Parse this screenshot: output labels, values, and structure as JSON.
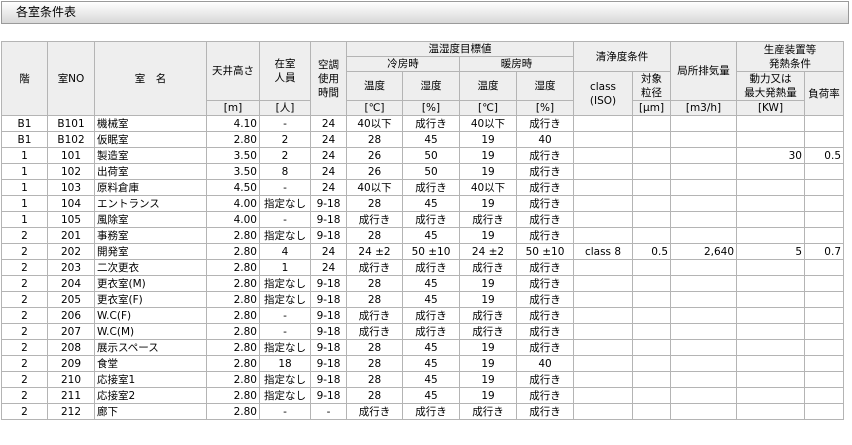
{
  "title": "各室条件表",
  "headers": {
    "floor": "階",
    "room_no": "室NO",
    "room_name": "室　名",
    "ceiling_height": "天井高さ",
    "occupants_1": "在室",
    "occupants_2": "人員",
    "ac_time_1": "空調",
    "ac_time_2": "使用",
    "ac_time_3": "時間",
    "temp_target": "温湿度目標値",
    "cooling": "冷房時",
    "heating": "暖房時",
    "temp": "温度",
    "humidity": "湿度",
    "cleanliness": "清浄度条件",
    "class_1": "class",
    "class_2": "(ISO)",
    "particle_1": "対象",
    "particle_2": "粒径",
    "exhaust": "局所排気量",
    "equipment_1": "生産装置等",
    "equipment_2": "発熱条件",
    "power_1": "動力又は",
    "power_2": "最大発熱量",
    "load_factor": "負荷率"
  },
  "units": {
    "ceiling_height": "[m]",
    "occupants": "[人]",
    "temp": "[℃]",
    "humidity": "[%]",
    "particle": "[μm]",
    "exhaust": "[m3/h]",
    "power": "[KW]"
  },
  "rows": [
    {
      "floor": "B1",
      "no": "B101",
      "name": "機械室",
      "height": "4.10",
      "people": "-",
      "time": "24",
      "ct": "40以下",
      "ch": "成行き",
      "ht": "40以下",
      "hh": "成行き",
      "cls": "",
      "part": "",
      "exh": "",
      "pow": "",
      "load": ""
    },
    {
      "floor": "B1",
      "no": "B102",
      "name": "仮眠室",
      "height": "2.80",
      "people": "2",
      "time": "24",
      "ct": "28",
      "ch": "45",
      "ht": "19",
      "hh": "40",
      "cls": "",
      "part": "",
      "exh": "",
      "pow": "",
      "load": ""
    },
    {
      "floor": "1",
      "no": "101",
      "name": "製造室",
      "height": "3.50",
      "people": "2",
      "time": "24",
      "ct": "26",
      "ch": "50",
      "ht": "19",
      "hh": "成行き",
      "cls": "",
      "part": "",
      "exh": "",
      "pow": "30",
      "load": "0.5"
    },
    {
      "floor": "1",
      "no": "102",
      "name": "出荷室",
      "height": "3.50",
      "people": "8",
      "time": "24",
      "ct": "26",
      "ch": "50",
      "ht": "19",
      "hh": "成行き",
      "cls": "",
      "part": "",
      "exh": "",
      "pow": "",
      "load": ""
    },
    {
      "floor": "1",
      "no": "103",
      "name": "原料倉庫",
      "height": "4.50",
      "people": "-",
      "time": "24",
      "ct": "40以下",
      "ch": "成行き",
      "ht": "40以下",
      "hh": "成行き",
      "cls": "",
      "part": "",
      "exh": "",
      "pow": "",
      "load": ""
    },
    {
      "floor": "1",
      "no": "104",
      "name": "エントランス",
      "height": "4.00",
      "people": "指定なし",
      "time": "9-18",
      "ct": "28",
      "ch": "45",
      "ht": "19",
      "hh": "成行き",
      "cls": "",
      "part": "",
      "exh": "",
      "pow": "",
      "load": ""
    },
    {
      "floor": "1",
      "no": "105",
      "name": "風除室",
      "height": "4.00",
      "people": "-",
      "time": "9-18",
      "ct": "成行き",
      "ch": "成行き",
      "ht": "成行き",
      "hh": "成行き",
      "cls": "",
      "part": "",
      "exh": "",
      "pow": "",
      "load": ""
    },
    {
      "floor": "2",
      "no": "201",
      "name": "事務室",
      "height": "2.80",
      "people": "指定なし",
      "time": "9-18",
      "ct": "28",
      "ch": "45",
      "ht": "19",
      "hh": "成行き",
      "cls": "",
      "part": "",
      "exh": "",
      "pow": "",
      "load": ""
    },
    {
      "floor": "2",
      "no": "202",
      "name": "開発室",
      "height": "2.80",
      "people": "4",
      "time": "24",
      "ct": "24 ±2",
      "ch": "50 ±10",
      "ht": "24 ±2",
      "hh": "50 ±10",
      "cls": "class 8",
      "part": "0.5",
      "exh": "2,640",
      "pow": "5",
      "load": "0.7"
    },
    {
      "floor": "2",
      "no": "203",
      "name": "二次更衣",
      "height": "2.80",
      "people": "1",
      "time": "24",
      "ct": "成行き",
      "ch": "成行き",
      "ht": "成行き",
      "hh": "成行き",
      "cls": "",
      "part": "",
      "exh": "",
      "pow": "",
      "load": ""
    },
    {
      "floor": "2",
      "no": "204",
      "name": "更衣室(M)",
      "height": "2.80",
      "people": "指定なし",
      "time": "9-18",
      "ct": "28",
      "ch": "45",
      "ht": "19",
      "hh": "成行き",
      "cls": "",
      "part": "",
      "exh": "",
      "pow": "",
      "load": ""
    },
    {
      "floor": "2",
      "no": "205",
      "name": "更衣室(F)",
      "height": "2.80",
      "people": "指定なし",
      "time": "9-18",
      "ct": "28",
      "ch": "45",
      "ht": "19",
      "hh": "成行き",
      "cls": "",
      "part": "",
      "exh": "",
      "pow": "",
      "load": ""
    },
    {
      "floor": "2",
      "no": "206",
      "name": "W.C(F)",
      "height": "2.80",
      "people": "-",
      "time": "9-18",
      "ct": "成行き",
      "ch": "成行き",
      "ht": "成行き",
      "hh": "成行き",
      "cls": "",
      "part": "",
      "exh": "",
      "pow": "",
      "load": ""
    },
    {
      "floor": "2",
      "no": "207",
      "name": "W.C(M)",
      "height": "2.80",
      "people": "-",
      "time": "9-18",
      "ct": "成行き",
      "ch": "成行き",
      "ht": "成行き",
      "hh": "成行き",
      "cls": "",
      "part": "",
      "exh": "",
      "pow": "",
      "load": ""
    },
    {
      "floor": "2",
      "no": "208",
      "name": "展示スペース",
      "height": "2.80",
      "people": "指定なし",
      "time": "9-18",
      "ct": "28",
      "ch": "45",
      "ht": "19",
      "hh": "成行き",
      "cls": "",
      "part": "",
      "exh": "",
      "pow": "",
      "load": ""
    },
    {
      "floor": "2",
      "no": "209",
      "name": "食堂",
      "height": "2.80",
      "people": "18",
      "time": "9-18",
      "ct": "28",
      "ch": "45",
      "ht": "19",
      "hh": "40",
      "cls": "",
      "part": "",
      "exh": "",
      "pow": "",
      "load": ""
    },
    {
      "floor": "2",
      "no": "210",
      "name": "応接室1",
      "height": "2.80",
      "people": "指定なし",
      "time": "9-18",
      "ct": "28",
      "ch": "45",
      "ht": "19",
      "hh": "成行き",
      "cls": "",
      "part": "",
      "exh": "",
      "pow": "",
      "load": ""
    },
    {
      "floor": "2",
      "no": "211",
      "name": "応接室2",
      "height": "2.80",
      "people": "指定なし",
      "time": "9-18",
      "ct": "28",
      "ch": "45",
      "ht": "19",
      "hh": "成行き",
      "cls": "",
      "part": "",
      "exh": "",
      "pow": "",
      "load": ""
    },
    {
      "floor": "2",
      "no": "212",
      "name": "廊下",
      "height": "2.80",
      "people": "-",
      "time": "-",
      "ct": "成行き",
      "ch": "成行き",
      "ht": "成行き",
      "hh": "成行き",
      "cls": "",
      "part": "",
      "exh": "",
      "pow": "",
      "load": ""
    }
  ]
}
